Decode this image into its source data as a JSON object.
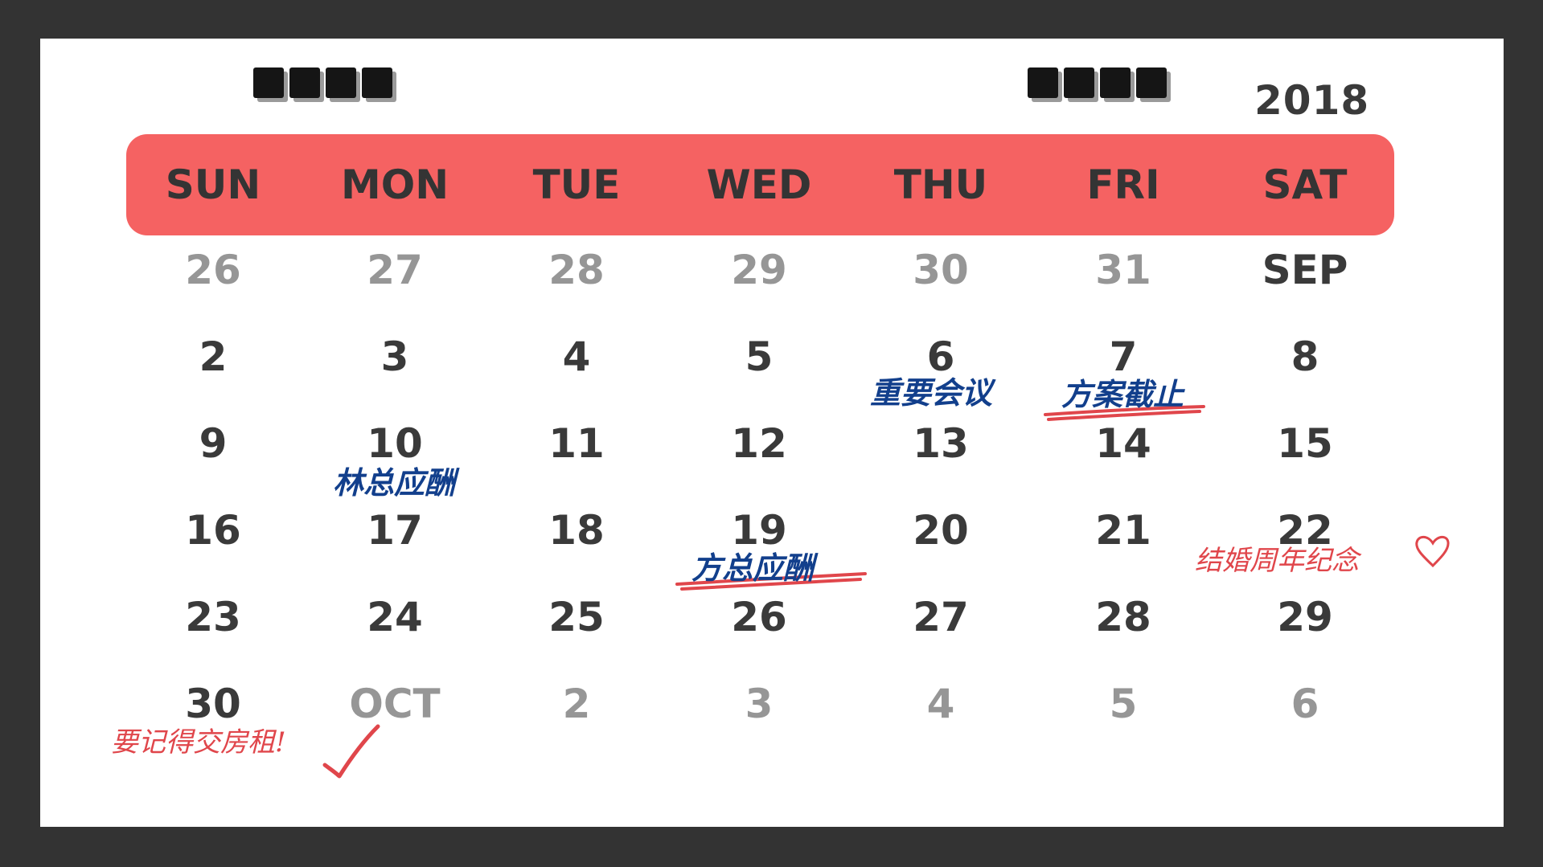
{
  "year": "2018",
  "weekdays": [
    "SUN",
    "MON",
    "TUE",
    "WED",
    "THU",
    "FRI",
    "SAT"
  ],
  "weeks": [
    [
      "26",
      "27",
      "28",
      "29",
      "30",
      "31",
      "SEP"
    ],
    [
      "2",
      "3",
      "4",
      "5",
      "6",
      "7",
      "8"
    ],
    [
      "9",
      "10",
      "11",
      "12",
      "13",
      "14",
      "15"
    ],
    [
      "16",
      "17",
      "18",
      "19",
      "20",
      "21",
      "22"
    ],
    [
      "23",
      "24",
      "25",
      "26",
      "27",
      "28",
      "29"
    ],
    [
      "30",
      "OCT",
      "2",
      "3",
      "4",
      "5",
      "6"
    ]
  ],
  "notes": {
    "important_meeting": "重要会议",
    "plan_deadline": "方案截止",
    "lin_dinner": "林总应酬",
    "fang_dinner": "方总应酬",
    "anniversary": "结婚周年纪念",
    "rent_reminder": "要记得交房租!"
  },
  "colors": {
    "background": "#333333",
    "card": "#ffffff",
    "header": "#f56262",
    "text": "#3a3a3a",
    "muted": "#969696",
    "note_blue": "#123f8c",
    "note_red": "#e0464b"
  }
}
